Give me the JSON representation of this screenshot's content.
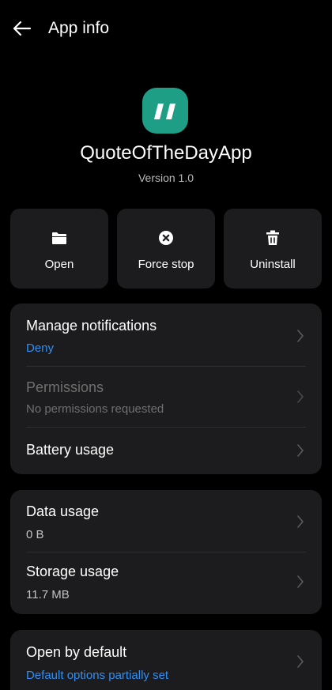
{
  "topbar": {
    "title": "App info",
    "back_icon": "arrow-left-icon"
  },
  "app": {
    "name": "QuoteOfTheDayApp",
    "version": "Version 1.0",
    "icon": "quote-icon",
    "icon_color": "#1f9e86"
  },
  "actions": [
    {
      "label": "Open",
      "icon": "folder-icon"
    },
    {
      "label": "Force stop",
      "icon": "stop-circle-icon"
    },
    {
      "label": "Uninstall",
      "icon": "trash-icon"
    }
  ],
  "card1": {
    "notifications": {
      "title": "Manage notifications",
      "value": "Deny"
    },
    "permissions": {
      "title": "Permissions",
      "value": "No permissions requested"
    },
    "battery": {
      "title": "Battery usage"
    }
  },
  "card2": {
    "data": {
      "title": "Data usage",
      "value": "0 B"
    },
    "storage": {
      "title": "Storage usage",
      "value": "11.7 MB"
    }
  },
  "card3": {
    "open_default": {
      "title": "Open by default",
      "value": "Default options partially set"
    }
  },
  "colors": {
    "background": "#000000",
    "card": "#1c1c1e",
    "accent": "#2f8ff5",
    "disabled": "#6f6f6f"
  }
}
